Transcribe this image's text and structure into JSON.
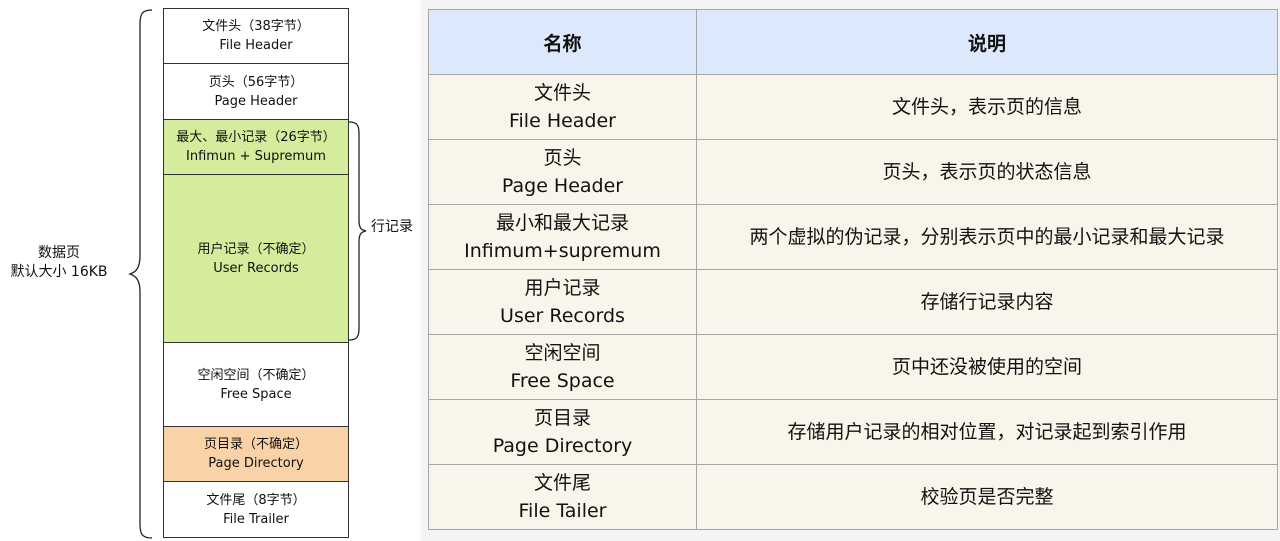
{
  "diagram": {
    "page_label": [
      "数据页",
      "默认大小 16KB"
    ],
    "blocks": [
      {
        "cn": "文件头（38字节）",
        "en": "File Header"
      },
      {
        "cn": "页头（56字节）",
        "en": "Page Header"
      },
      {
        "cn": "最大、最小记录（26字节）",
        "en": "Infimun + Supremum"
      },
      {
        "cn": "用户记录（不确定）",
        "en": "User Records"
      },
      {
        "cn": "空闲空间（不确定）",
        "en": "Free Space"
      },
      {
        "cn": "页目录（不确定）",
        "en": "Page Directory"
      },
      {
        "cn": "文件尾（8字节）",
        "en": "File Trailer"
      }
    ],
    "row_records_label": "行记录",
    "colors": {
      "green": "#d4ec9b",
      "orange": "#fad2a8"
    }
  },
  "table": {
    "headers": [
      "名称",
      "说明"
    ],
    "rows": [
      {
        "name_cn": "文件头",
        "name_en": "File Header",
        "desc": "文件头，表示页的信息"
      },
      {
        "name_cn": "页头",
        "name_en": "Page Header",
        "desc": "页头，表示页的状态信息"
      },
      {
        "name_cn": "最小和最大记录",
        "name_en": "Infimum+supremum",
        "desc": "两个虚拟的伪记录，分别表示页中的最小记录和最大记录"
      },
      {
        "name_cn": "用户记录",
        "name_en": "User Records",
        "desc": "存储行记录内容"
      },
      {
        "name_cn": "空闲空间",
        "name_en": "Free Space",
        "desc": "页中还没被使用的空间"
      },
      {
        "name_cn": "页目录",
        "name_en": "Page Directory",
        "desc": "存储用户记录的相对位置，对记录起到索引作用"
      },
      {
        "name_cn": "文件尾",
        "name_en": "File Tailer",
        "desc": "校验页是否完整"
      }
    ],
    "colors": {
      "header_bg": "#dce8fb",
      "cell_bg": "#f8f6ea"
    }
  }
}
